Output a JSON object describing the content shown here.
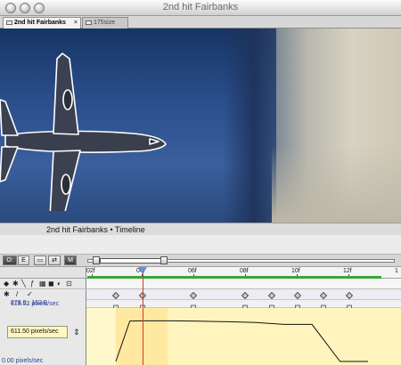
{
  "composition": {
    "window_title": "2nd hit Fairbanks",
    "tabs": [
      {
        "label": "2nd hit Fairbanks",
        "close": "×",
        "active": true
      },
      {
        "label": "175size",
        "active": false
      }
    ]
  },
  "timeline": {
    "title": "2nd hit Fairbanks • Timeline",
    "toolbar": [
      "O:",
      "E",
      "▭",
      "⇄",
      "M"
    ],
    "ruler": [
      "02f",
      "04f",
      "06f",
      "08f",
      "10f",
      "12f",
      "1"
    ],
    "position_value": "278.0 , 162.0",
    "velocity_top": "613.52 pixels/sec",
    "velocity_current": "611.50 pixels/sec",
    "velocity_bottom": "0.00 pixels/sec",
    "row2_icons": [
      "◆",
      "✱",
      "╲",
      "ƒ",
      "▦",
      "◼",
      "◐",
      "⊡"
    ],
    "row3_icons": [
      "✱",
      "/",
      "✓"
    ]
  },
  "graph_data": {
    "type": "line",
    "x": [
      0,
      0.5,
      1,
      2,
      3,
      3.5,
      4,
      5,
      6,
      7,
      8,
      9
    ],
    "y": [
      0,
      611.5,
      613.5,
      613.5,
      610,
      605,
      600,
      590,
      560,
      560,
      0,
      0
    ]
  },
  "colors": {
    "viewer_sky": "#2a4d8a",
    "building": "#cfc8b6",
    "graph_bg": "#fff4bd",
    "work_area": "#3aa63a",
    "cti": "#d43a2a"
  }
}
